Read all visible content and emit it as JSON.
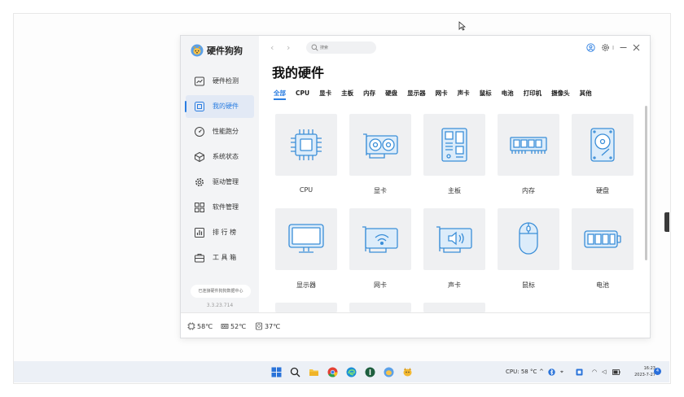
{
  "app": {
    "name": "硬件狗狗"
  },
  "nav": {
    "items": [
      {
        "label": "硬件检测",
        "icon": "chart-icon"
      },
      {
        "label": "我的硬件",
        "icon": "hardware-icon",
        "active": true
      },
      {
        "label": "性能跑分",
        "icon": "speedometer-icon"
      },
      {
        "label": "系统状态",
        "icon": "cube-icon"
      },
      {
        "label": "驱动管理",
        "icon": "gear-icon"
      },
      {
        "label": "软件管理",
        "icon": "grid-icon"
      },
      {
        "label": "排 行 榜",
        "icon": "ranking-icon"
      },
      {
        "label": "工 具 箱",
        "icon": "toolbox-icon"
      }
    ],
    "sync_label": "已连接硬件狗狗数据中心",
    "version": "3.3.23.714"
  },
  "search": {
    "placeholder": "搜索"
  },
  "page": {
    "title": "我的硬件"
  },
  "tabs": [
    "全部",
    "CPU",
    "显卡",
    "主板",
    "内存",
    "硬盘",
    "显示器",
    "网卡",
    "声卡",
    "鼠标",
    "电池",
    "打印机",
    "摄像头",
    "其他"
  ],
  "hardware": [
    {
      "label": "CPU",
      "icon": "cpu-icon"
    },
    {
      "label": "显卡",
      "icon": "gpu-icon"
    },
    {
      "label": "主板",
      "icon": "motherboard-icon"
    },
    {
      "label": "内存",
      "icon": "memory-icon"
    },
    {
      "label": "硬盘",
      "icon": "hard-disk-icon"
    },
    {
      "label": "显示器",
      "icon": "monitor-icon"
    },
    {
      "label": "网卡",
      "icon": "network-card-icon"
    },
    {
      "label": "声卡",
      "icon": "sound-card-icon"
    },
    {
      "label": "鼠标",
      "icon": "mouse-icon"
    },
    {
      "label": "电池",
      "icon": "battery-icon"
    }
  ],
  "temps": {
    "cpu": "58℃",
    "gpu": "52℃",
    "disk": "37℃"
  },
  "taskbar": {
    "tray_cpu": "CPU: 58 °C",
    "time": "16:23",
    "date": "2023-7-27",
    "notifications": "4"
  },
  "colors": {
    "accent": "#2a7de1",
    "icon_blue": "#3a8ed8"
  }
}
